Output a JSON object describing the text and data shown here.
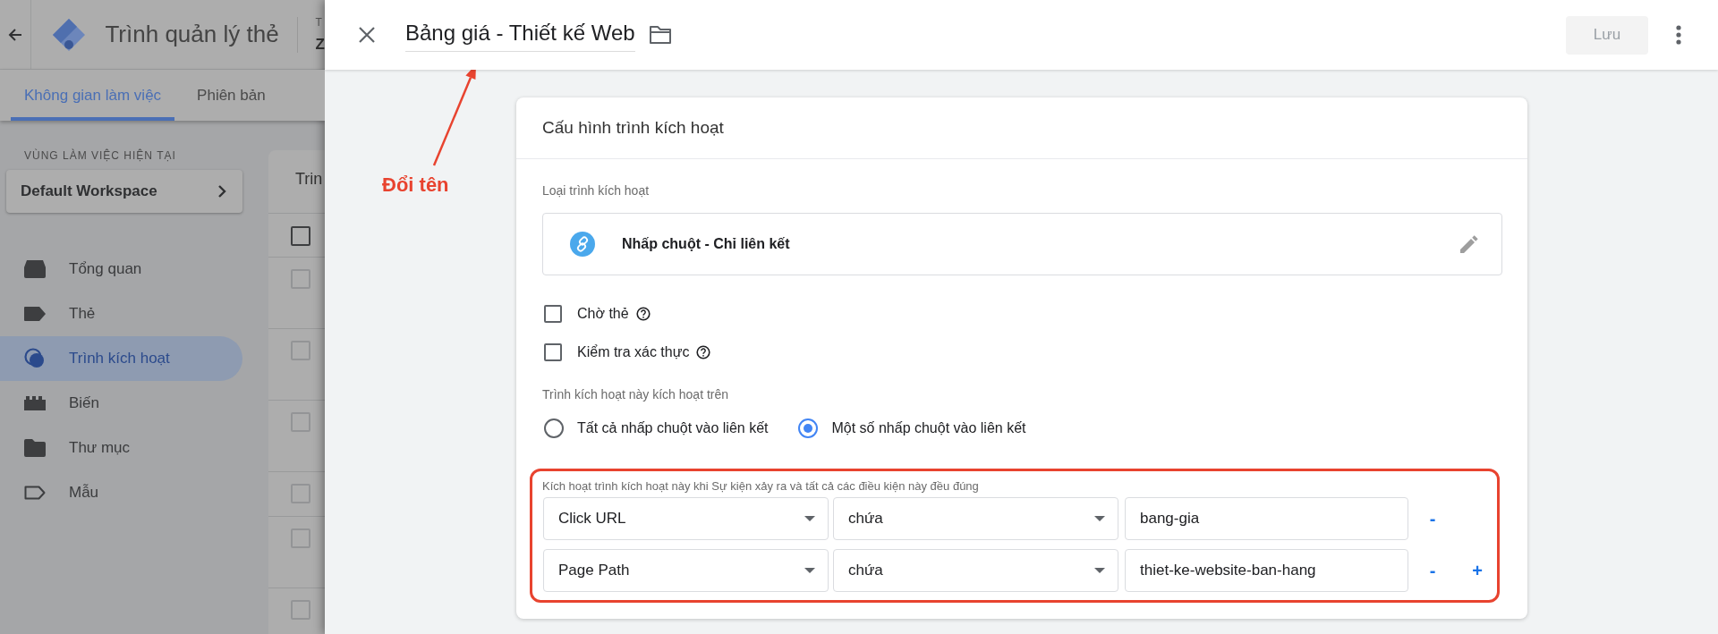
{
  "background_page": {
    "app_title": "Trình quản lý thẻ",
    "account_fragment_1": "T",
    "account_fragment_2": "Z",
    "tabs": [
      {
        "label": "Không gian làm việc",
        "selected": true
      },
      {
        "label": "Phiên bản",
        "selected": false
      }
    ],
    "workspace": {
      "heading": "VÙNG LÀM VIỆC HIỆN TẠI",
      "name": "Default Workspace"
    },
    "nav_items": [
      {
        "label": "Tổng quan",
        "kind": "overview",
        "selected": false
      },
      {
        "label": "Thẻ",
        "kind": "tag",
        "selected": false
      },
      {
        "label": "Trình kích hoạt",
        "kind": "trigger",
        "selected": true
      },
      {
        "label": "Biến",
        "kind": "variable",
        "selected": false
      },
      {
        "label": "Thư mục",
        "kind": "folder",
        "selected": false
      },
      {
        "label": "Mẫu",
        "kind": "template",
        "selected": false
      }
    ],
    "table": {
      "title": "Trin",
      "header_checked": false,
      "rows": [
        {
          "checked": false
        },
        {
          "checked": false
        },
        {
          "checked": false
        },
        {
          "checked": false
        },
        {
          "checked": false
        },
        {
          "checked": false
        }
      ]
    }
  },
  "sheet": {
    "title": "Bảng giá - Thiết kế Web",
    "save_label": "Lưu",
    "save_disabled": true
  },
  "annotation": {
    "label": "Đổi tên"
  },
  "card": {
    "title": "Cấu hình trình kích hoạt",
    "type_label": "Loại trình kích hoạt",
    "type_name": "Nhấp chuột - Chỉ liên kết",
    "options": [
      {
        "label": "Chờ thẻ",
        "checked": false
      },
      {
        "label": "Kiểm tra xác thực",
        "checked": false
      }
    ],
    "fire_on_label": "Trình kích hoạt này kích hoạt trên",
    "fire_on": [
      {
        "label": "Tất cả nhấp chuột vào liên kết",
        "selected": false
      },
      {
        "label": "Một số nhấp chuột vào liên kết",
        "selected": true
      }
    ],
    "conditions_label": "Kích hoạt trình kích hoạt này khi Sự kiện xảy ra và tất cả các điều kiện này đều đúng",
    "conditions": [
      {
        "variable": "Click URL",
        "operator": "chứa",
        "value": "bang-gia",
        "actions": [
          "-"
        ]
      },
      {
        "variable": "Page Path",
        "operator": "chứa",
        "value": "thiet-ke-website-ban-hang",
        "actions": [
          "-",
          "+"
        ]
      }
    ]
  }
}
